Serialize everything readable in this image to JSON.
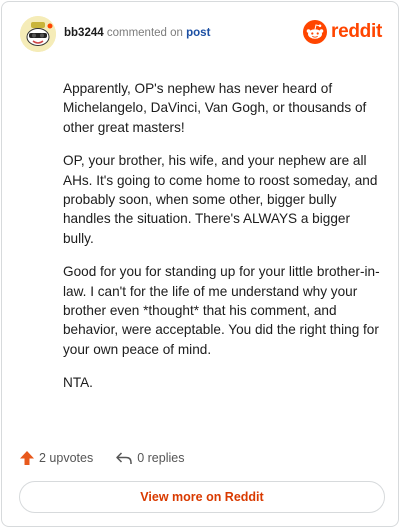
{
  "header": {
    "username": "bb3244",
    "action_text": "commented on",
    "post_link": "post",
    "brand": "reddit"
  },
  "comment": {
    "paragraphs": [
      "Apparently, OP's nephew has never heard of Michelangelo, DaVinci, Van Gogh, or thousands of other great masters!",
      "OP, your brother, his wife, and your nephew are all AHs. It's going to come home to roost someday, and probably soon, when some other, bigger bully handles the situation. There's ALWAYS a bigger bully.",
      "Good for you for standing up for your little brother-in-law. I can't for the life of me understand why your brother even *thought* that his comment, and behavior, were acceptable. You did the right thing for your own peace of mind.",
      "NTA."
    ]
  },
  "footer": {
    "upvotes": "2 upvotes",
    "replies": "0 replies",
    "view_more": "View more on Reddit"
  },
  "colors": {
    "brand_orange": "#ff4500",
    "upvote_orange": "#e8591c",
    "link_blue": "#1c4fa3",
    "button_text": "#d93a00"
  }
}
